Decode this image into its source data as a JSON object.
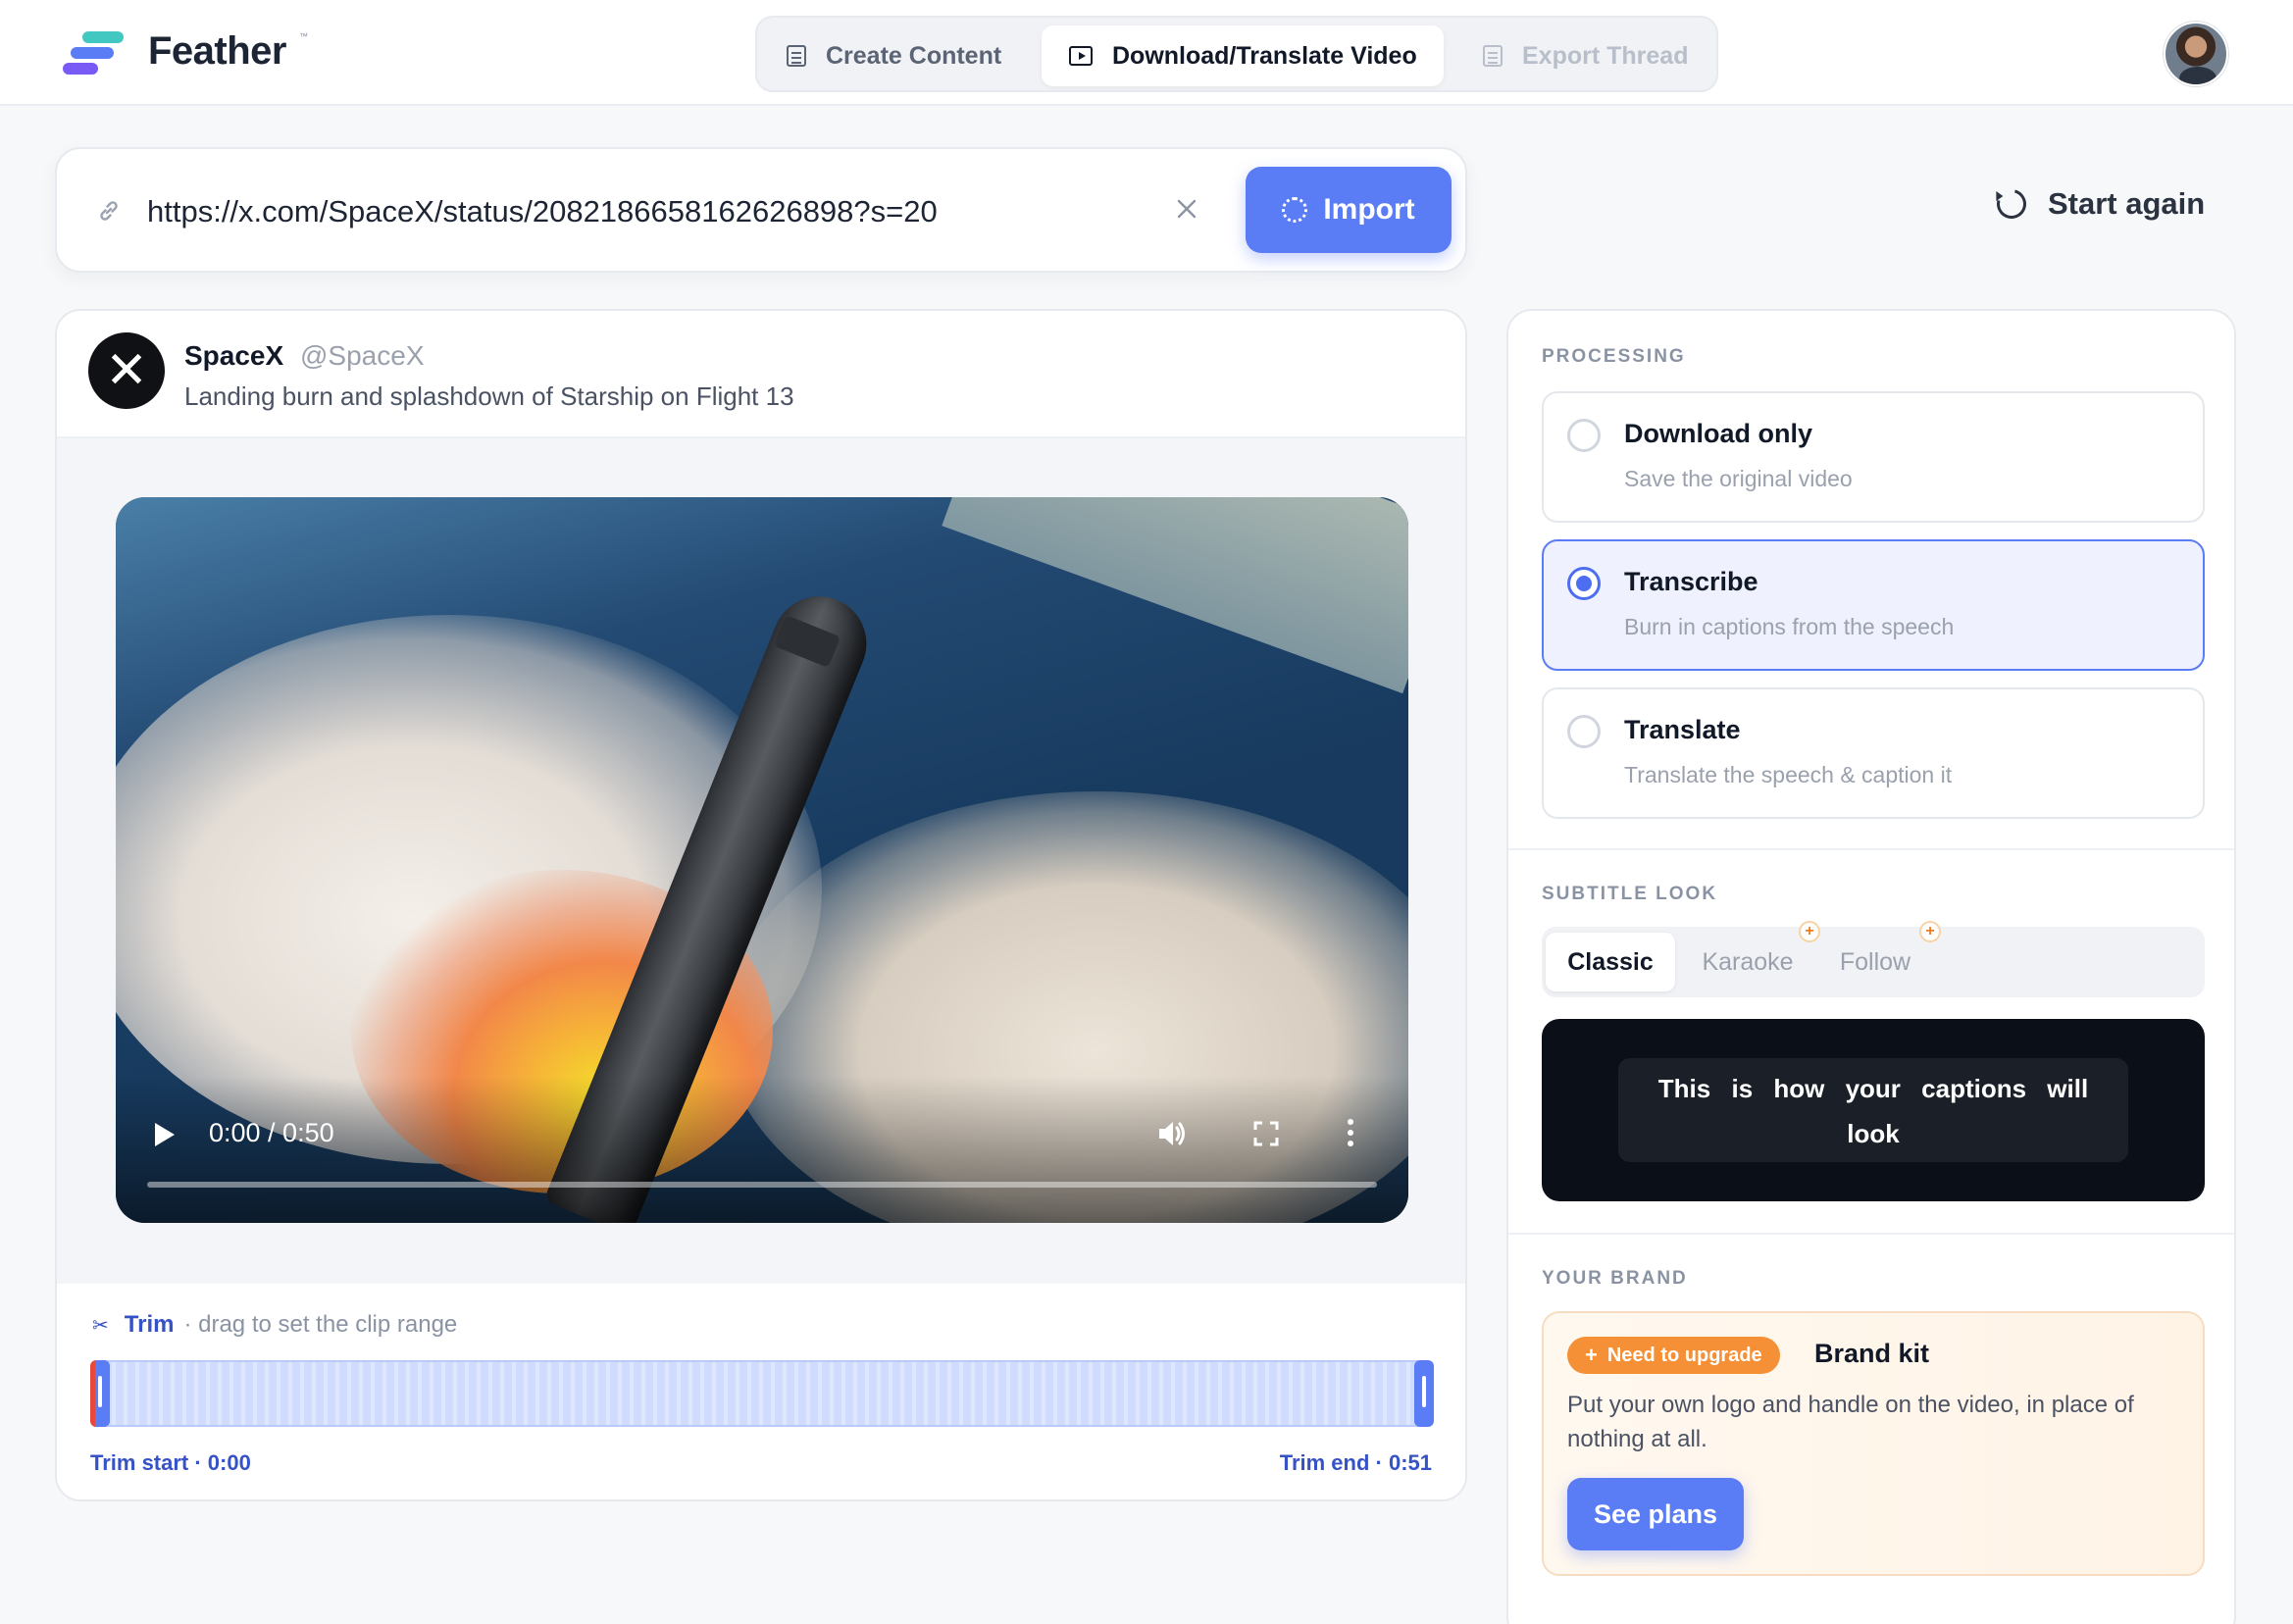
{
  "app": {
    "brand_name": "Feather",
    "brand_mark": "™"
  },
  "nav": {
    "tabs": [
      {
        "label": "Create Content",
        "icon": "document-icon",
        "state": "normal"
      },
      {
        "label": "Download/Translate Video",
        "icon": "video-icon",
        "state": "active"
      },
      {
        "label": "Export Thread",
        "icon": "document-icon",
        "state": "disabled"
      }
    ]
  },
  "import": {
    "url_value": "https://x.com/SpaceX/status/2082186658162626898?s=20",
    "button_label": "Import"
  },
  "start_again_label": "Start again",
  "tweet": {
    "author_name": "SpaceX",
    "author_handle": "@SpaceX",
    "text": "Landing burn and splashdown of Starship on Flight 13"
  },
  "video": {
    "time_display": "0:00 / 0:50",
    "progress_fraction": 0
  },
  "trim": {
    "title": "Trim",
    "hint": "· drag to set the clip range",
    "start_label": "Trim start · 0:00",
    "end_label": "Trim end · 0:51"
  },
  "processing": {
    "section_title": "PROCESSING",
    "options": [
      {
        "title": "Download only",
        "subtitle": "Save the original video",
        "selected": false
      },
      {
        "title": "Transcribe",
        "subtitle": "Burn in captions from the speech",
        "selected": true
      },
      {
        "title": "Translate",
        "subtitle": "Translate the speech & caption it",
        "selected": false
      }
    ]
  },
  "subtitle_look": {
    "section_title": "SUBTITLE LOOK",
    "tabs": [
      {
        "label": "Classic",
        "active": true,
        "premium": false
      },
      {
        "label": "Karaoke",
        "active": false,
        "premium": true
      },
      {
        "label": "Follow",
        "active": false,
        "premium": true
      }
    ],
    "preview_text": "This is how your captions will look"
  },
  "brand": {
    "section_title": "YOUR BRAND",
    "badge_label": "Need to upgrade",
    "title": "Brand kit",
    "description": "Put your own logo and handle on the video, in place of nothing at all.",
    "button_label": "See plans"
  },
  "colors": {
    "accent": "#5a7cf5",
    "accent_dark": "#3652c7",
    "upgrade_orange": "#f59036"
  }
}
